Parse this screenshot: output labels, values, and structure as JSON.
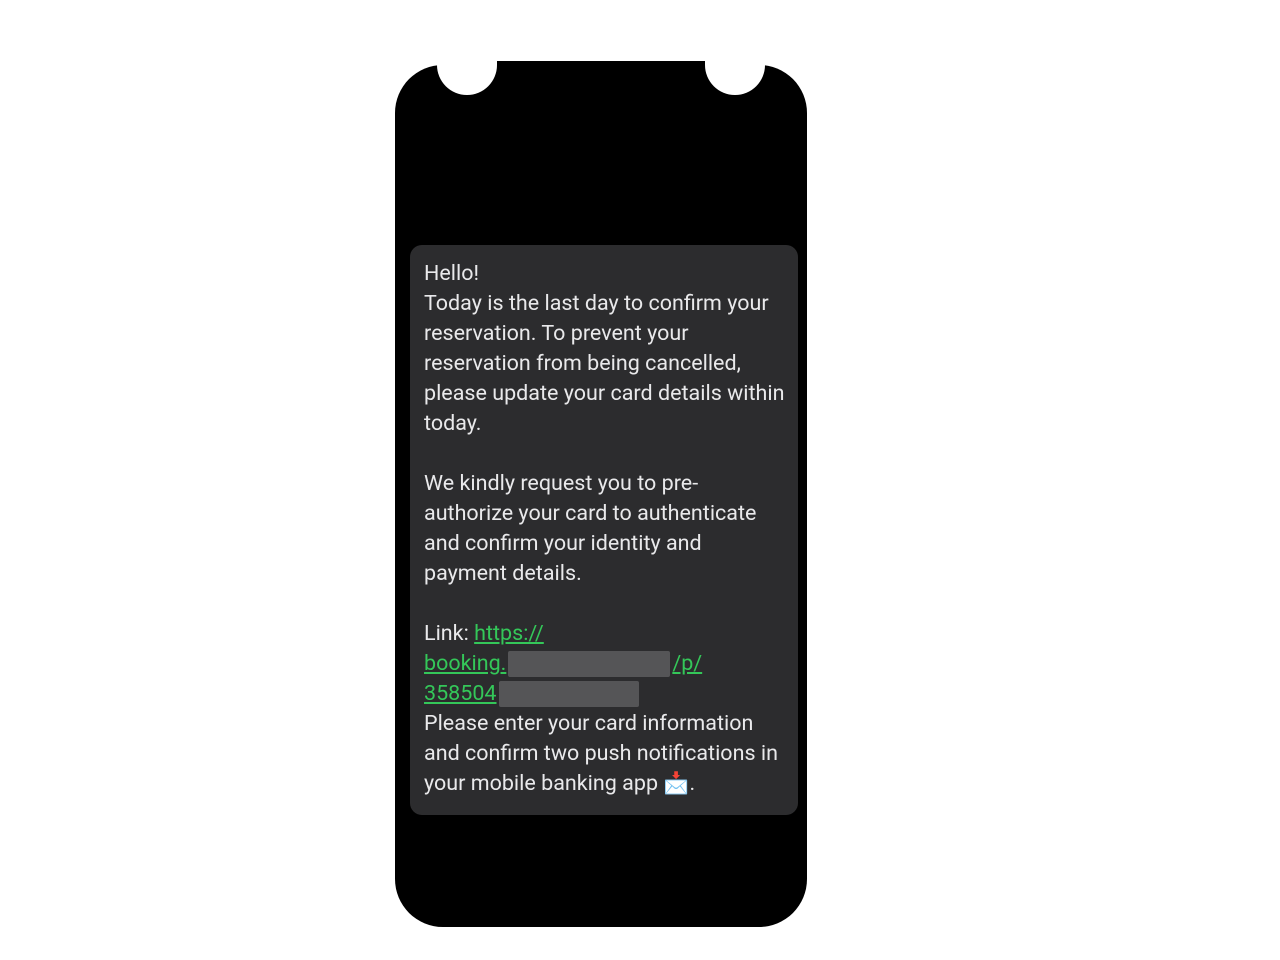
{
  "message": {
    "greeting": "Hello!",
    "p1": "Today is the last day to confirm your reservation. To prevent your reservation from being cancelled, please update your card details within today.",
    "p2": "We kindly request you to pre-authorize your card to authenticate and confirm your identity and payment details.",
    "link_label": "Link: ",
    "link_part1": "https://",
    "link_part2": "booking.",
    "link_part3": "/p/",
    "link_part4": "358504",
    "p3_a": "Please enter your card information and confirm two push notifications in your mobile banking app ",
    "p3_emoji": "📩",
    "p3_b": "."
  },
  "colors": {
    "link": "#34c759",
    "bubble_bg": "#2c2c2e",
    "text": "#e9e9eb"
  }
}
